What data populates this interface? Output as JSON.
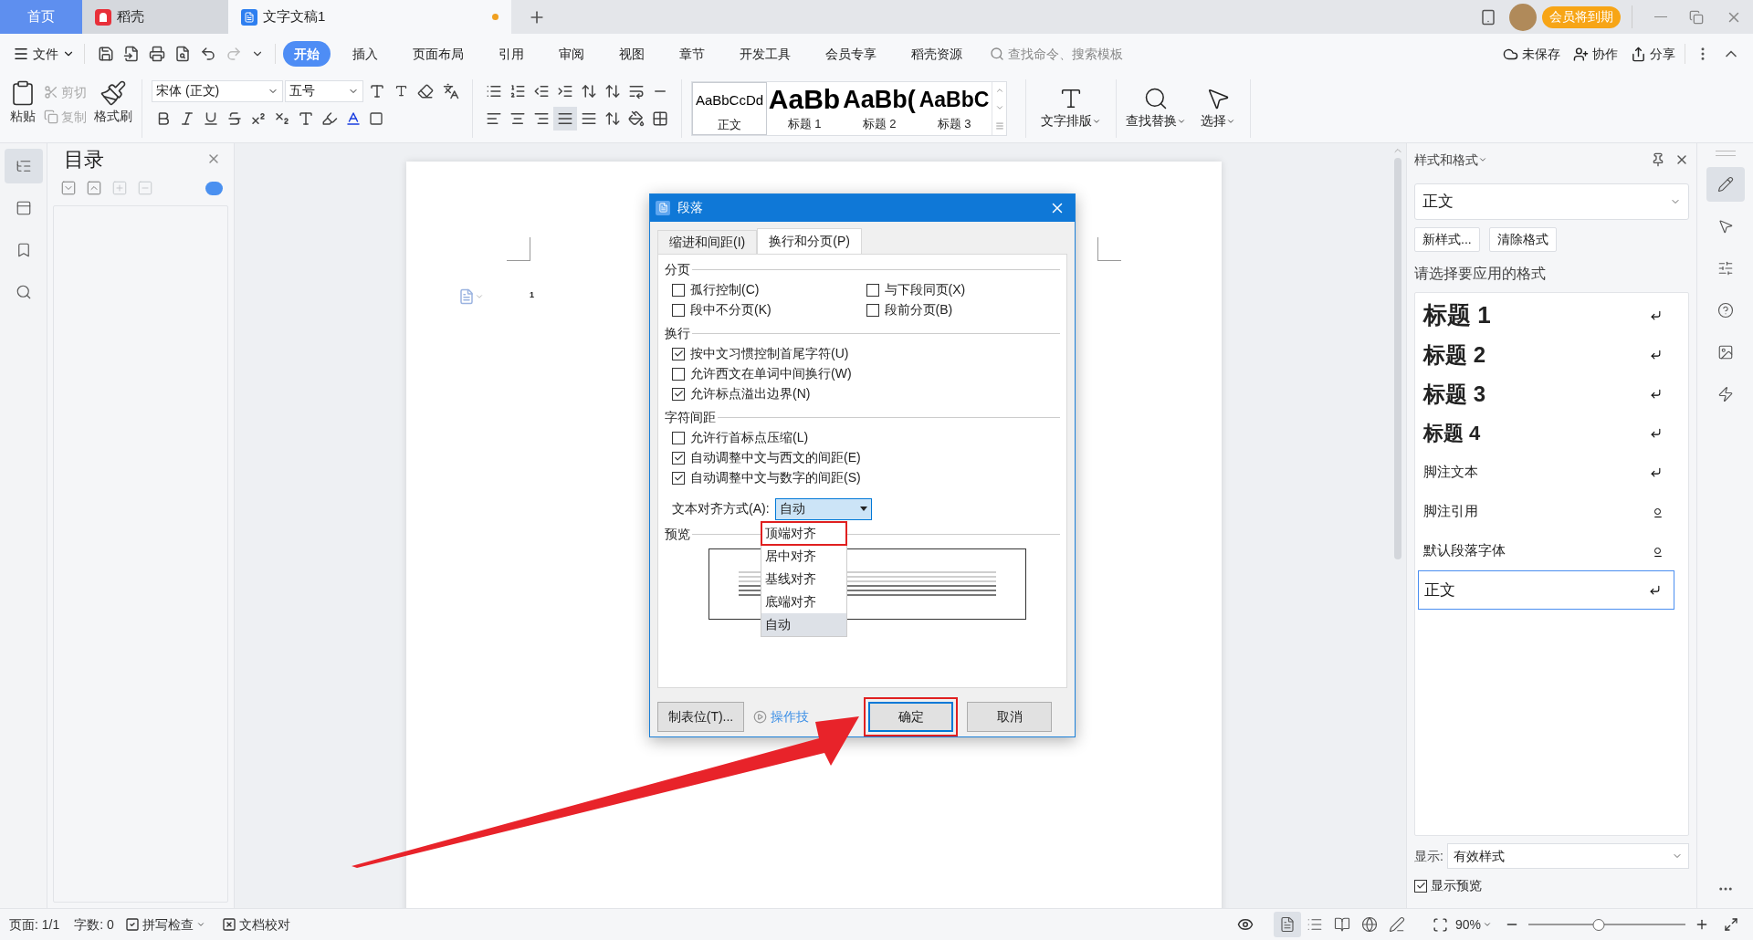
{
  "tabs": [
    {
      "label": "首页",
      "kind": "home",
      "selected": false,
      "unsaved": false
    },
    {
      "label": "稻壳",
      "kind": "docer",
      "selected": false,
      "unsaved": false
    },
    {
      "label": "文字文稿1",
      "kind": "doc",
      "selected": true,
      "unsaved": true
    }
  ],
  "member_badge": "会员将到期",
  "menu": {
    "file": "文件",
    "items": [
      {
        "label": "开始",
        "selected": true
      },
      {
        "label": "插入",
        "selected": false
      },
      {
        "label": "页面布局",
        "selected": false
      },
      {
        "label": "引用",
        "selected": false
      },
      {
        "label": "审阅",
        "selected": false
      },
      {
        "label": "视图",
        "selected": false
      },
      {
        "label": "章节",
        "selected": false
      },
      {
        "label": "开发工具",
        "selected": false
      },
      {
        "label": "会员专享",
        "selected": false
      },
      {
        "label": "稻壳资源",
        "selected": false
      }
    ],
    "search_placeholder": "查找命令、搜索模板",
    "actions": [
      {
        "label": "未保存",
        "kind": "cloud"
      },
      {
        "label": "协作",
        "kind": "user"
      },
      {
        "label": "分享",
        "kind": "share"
      }
    ]
  },
  "ribbon": {
    "paste": "粘贴",
    "cut": {
      "label": "剪切",
      "disabled": true
    },
    "copy": {
      "label": "复制",
      "disabled": true
    },
    "format_painter": "格式刷",
    "font": "宋体 (正文)",
    "size": "五号",
    "styles": [
      {
        "preview": "AaBbCcDd",
        "label": "正文",
        "kind": "body",
        "selected": true
      },
      {
        "preview": "AaBb",
        "label": "标题 1",
        "kind": "h1",
        "selected": false
      },
      {
        "preview": "AaBb(",
        "label": "标题 2",
        "kind": "h2",
        "selected": false
      },
      {
        "preview": "AaBbC",
        "label": "标题 3",
        "kind": "h3",
        "selected": false
      }
    ],
    "text_layout": "文字排版",
    "find_replace": "查找替换",
    "select": "选择"
  },
  "left_strip": [
    {
      "kind": "toc",
      "selected": true
    },
    {
      "kind": "nav",
      "selected": false
    },
    {
      "kind": "bookmark",
      "selected": false
    },
    {
      "kind": "search",
      "selected": false
    }
  ],
  "toc_panel": {
    "title": "目录"
  },
  "page": {
    "mark": "1"
  },
  "dialog": {
    "title": "段落",
    "tabs": [
      {
        "label": "缩进和间距(I)",
        "selected": false
      },
      {
        "label": "换行和分页(P)",
        "selected": true
      }
    ],
    "sections": [
      {
        "title": "分页",
        "kind": "grid",
        "options": [
          {
            "label": "孤行控制(C)",
            "checked": false
          },
          {
            "label": "与下段同页(X)",
            "checked": false
          },
          {
            "label": "段中不分页(K)",
            "checked": false
          },
          {
            "label": "段前分页(B)",
            "checked": false
          }
        ]
      },
      {
        "title": "换行",
        "kind": "list",
        "options": [
          {
            "label": "按中文习惯控制首尾字符(U)",
            "checked": true
          },
          {
            "label": "允许西文在单词中间换行(W)",
            "checked": false
          },
          {
            "label": "允许标点溢出边界(N)",
            "checked": true
          }
        ]
      },
      {
        "title": "字符间距",
        "kind": "list",
        "options": [
          {
            "label": "允许行首标点压缩(L)",
            "checked": false
          },
          {
            "label": "自动调整中文与西文的间距(E)",
            "checked": true
          },
          {
            "label": "自动调整中文与数字的间距(S)",
            "checked": true
          }
        ]
      }
    ],
    "alignment": {
      "label": "文本对齐方式(A):",
      "value": "自动",
      "expanded": true,
      "options": [
        {
          "label": "顶端对齐",
          "selected": false,
          "highlighted": true
        },
        {
          "label": "居中对齐",
          "selected": false,
          "highlighted": false
        },
        {
          "label": "基线对齐",
          "selected": false,
          "highlighted": false
        },
        {
          "label": "底端对齐",
          "selected": false,
          "highlighted": false
        },
        {
          "label": "自动",
          "selected": true,
          "highlighted": false
        }
      ]
    },
    "preview_title": "预览",
    "buttons": [
      {
        "label": "制表位(T)...",
        "kind": "plain",
        "highlighted": false
      },
      {
        "label": "操作技",
        "kind": "link",
        "highlighted": false
      },
      {
        "label": "确定",
        "kind": "default",
        "highlighted": true
      },
      {
        "label": "取消",
        "kind": "plain",
        "highlighted": false
      }
    ]
  },
  "styles_panel": {
    "title": "样式和格式",
    "current": "正文",
    "buttons": [
      "新样式...",
      "清除格式"
    ],
    "prompt": "请选择要应用的格式",
    "items": [
      {
        "label": "标题 1",
        "kind": "h1",
        "paragraph_style": true,
        "selected": false
      },
      {
        "label": "标题 2",
        "kind": "h2",
        "paragraph_style": true,
        "selected": false
      },
      {
        "label": "标题 3",
        "kind": "h3",
        "paragraph_style": true,
        "selected": false
      },
      {
        "label": "标题 4",
        "kind": "h4",
        "paragraph_style": true,
        "selected": false
      },
      {
        "label": "脚注文本",
        "kind": "body",
        "paragraph_style": true,
        "selected": false
      },
      {
        "label": "脚注引用",
        "kind": "body",
        "paragraph_style": false,
        "selected": false
      },
      {
        "label": "默认段落字体",
        "kind": "body",
        "paragraph_style": false,
        "selected": false
      },
      {
        "label": "正文",
        "kind": "normal",
        "paragraph_style": true,
        "selected": true
      }
    ],
    "show_label": "显示:",
    "show_value": "有效样式",
    "preview_label": "显示预览",
    "preview_checked": true
  },
  "right_strip": [
    {
      "kind": "pen",
      "selected": true
    },
    {
      "kind": "pointer",
      "selected": false
    },
    {
      "kind": "sliders",
      "selected": false
    },
    {
      "kind": "help",
      "selected": false
    },
    {
      "kind": "image",
      "selected": false
    },
    {
      "kind": "bolt",
      "selected": false
    }
  ],
  "status": {
    "page": "页面: 1/1",
    "words": "字数: 0",
    "spell": "拼写检查",
    "proof": "文档校对",
    "zoom": "90%",
    "zoom_slider": {
      "level": 0.45
    },
    "views": [
      {
        "kind": "page",
        "selected": true
      },
      {
        "kind": "outline",
        "selected": false
      },
      {
        "kind": "read",
        "selected": false
      },
      {
        "kind": "web",
        "selected": false
      },
      {
        "kind": "write",
        "selected": false
      }
    ]
  }
}
